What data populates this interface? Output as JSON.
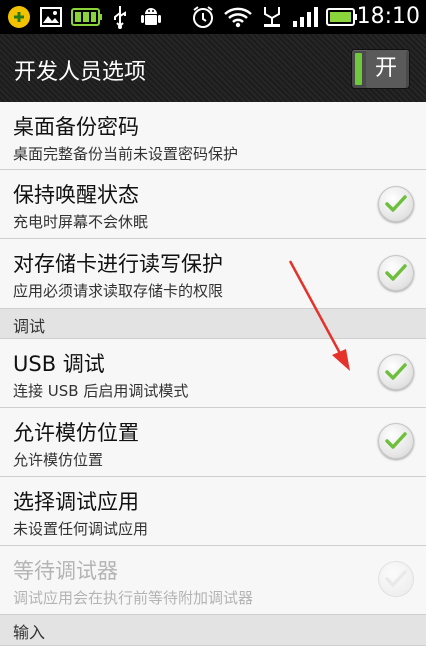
{
  "status_bar": {
    "time": "18:10",
    "icons": [
      "app-store-icon",
      "image-icon",
      "battery-saver-icon",
      "usb-icon",
      "android-debug-icon",
      "alarm-clock-icon",
      "wifi-icon",
      "usb-charging-icon",
      "signal-icon",
      "battery-icon"
    ]
  },
  "header": {
    "title": "开发人员选项",
    "toggle_label": "开"
  },
  "items": [
    {
      "title": "桌面备份密码",
      "subtitle": "桌面完整备份当前未设置密码保护",
      "checkable": false
    },
    {
      "title": "保持唤醒状态",
      "subtitle": "充电时屏幕不会休眠",
      "checked": true
    },
    {
      "title": "对存储卡进行读写保护",
      "subtitle": "应用必须请求读取存储卡的权限",
      "checked": true
    }
  ],
  "sections": [
    {
      "label": "调试"
    },
    {
      "label": "输入"
    }
  ],
  "debug_items": [
    {
      "title": "USB 调试",
      "subtitle": "连接 USB 后启用调试模式",
      "checked": true
    },
    {
      "title": "允许模仿位置",
      "subtitle": "允许模仿位置",
      "checked": true
    },
    {
      "title": "选择调试应用",
      "subtitle": "未设置任何调试应用",
      "checkable": false
    },
    {
      "title": "等待调试器",
      "subtitle": "调试应用会在执行前等待附加调试器",
      "checked": false,
      "disabled": true
    }
  ],
  "colors": {
    "check_green": "#6fbf3f",
    "toggle_green": "#6dc83a",
    "annotation_arrow": "#e5322b"
  }
}
